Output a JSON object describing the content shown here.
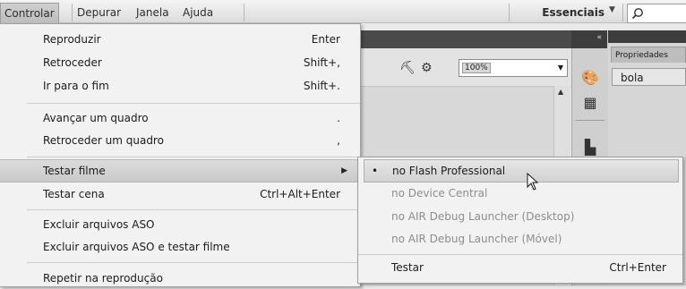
{
  "menubar": {
    "items": [
      {
        "label": "Controlar",
        "active": true
      },
      {
        "label": "Depurar",
        "active": false
      },
      {
        "label": "Janela",
        "active": false
      },
      {
        "label": "Ajuda",
        "active": false
      }
    ],
    "workspace": "Essenciais"
  },
  "document": {
    "zoom": "100%"
  },
  "properties": {
    "tab_label": "Propriedades",
    "instance_name": "bola"
  },
  "control_menu": {
    "items": [
      {
        "label": "Reproduzir",
        "shortcut": "Enter"
      },
      {
        "label": "Retroceder",
        "shortcut": "Shift+,"
      },
      {
        "label": "Ir para o fim",
        "shortcut": "Shift+."
      },
      {
        "label": "Avançar um quadro",
        "shortcut": "."
      },
      {
        "label": "Retroceder um quadro",
        "shortcut": ","
      },
      {
        "label": "Testar filme",
        "shortcut": "",
        "submenu": true,
        "highlighted": true
      },
      {
        "label": "Testar cena",
        "shortcut": "Ctrl+Alt+Enter"
      },
      {
        "label": "Excluir arquivos ASO",
        "shortcut": ""
      },
      {
        "label": "Excluir arquivos ASO e testar filme",
        "shortcut": ""
      },
      {
        "label": "Repetir na reprodução",
        "shortcut": ""
      }
    ]
  },
  "test_movie_submenu": {
    "items": [
      {
        "label": "no Flash Professional",
        "shortcut": "",
        "checked": true,
        "enabled": true
      },
      {
        "label": "no Device Central",
        "shortcut": "",
        "checked": false,
        "enabled": false
      },
      {
        "label": "no AIR Debug Launcher (Desktop)",
        "shortcut": "",
        "checked": false,
        "enabled": false
      },
      {
        "label": "no AIR Debug Launcher (Móvel)",
        "shortcut": "",
        "checked": false,
        "enabled": false
      },
      {
        "label": "Testar",
        "shortcut": "Ctrl+Enter",
        "checked": false,
        "enabled": true
      }
    ]
  },
  "icons": {
    "search": "magnifier-icon",
    "dropdown": "chevron-down-icon",
    "submenu": "triangle-right-icon",
    "cursor": "mouse-pointer-icon"
  }
}
